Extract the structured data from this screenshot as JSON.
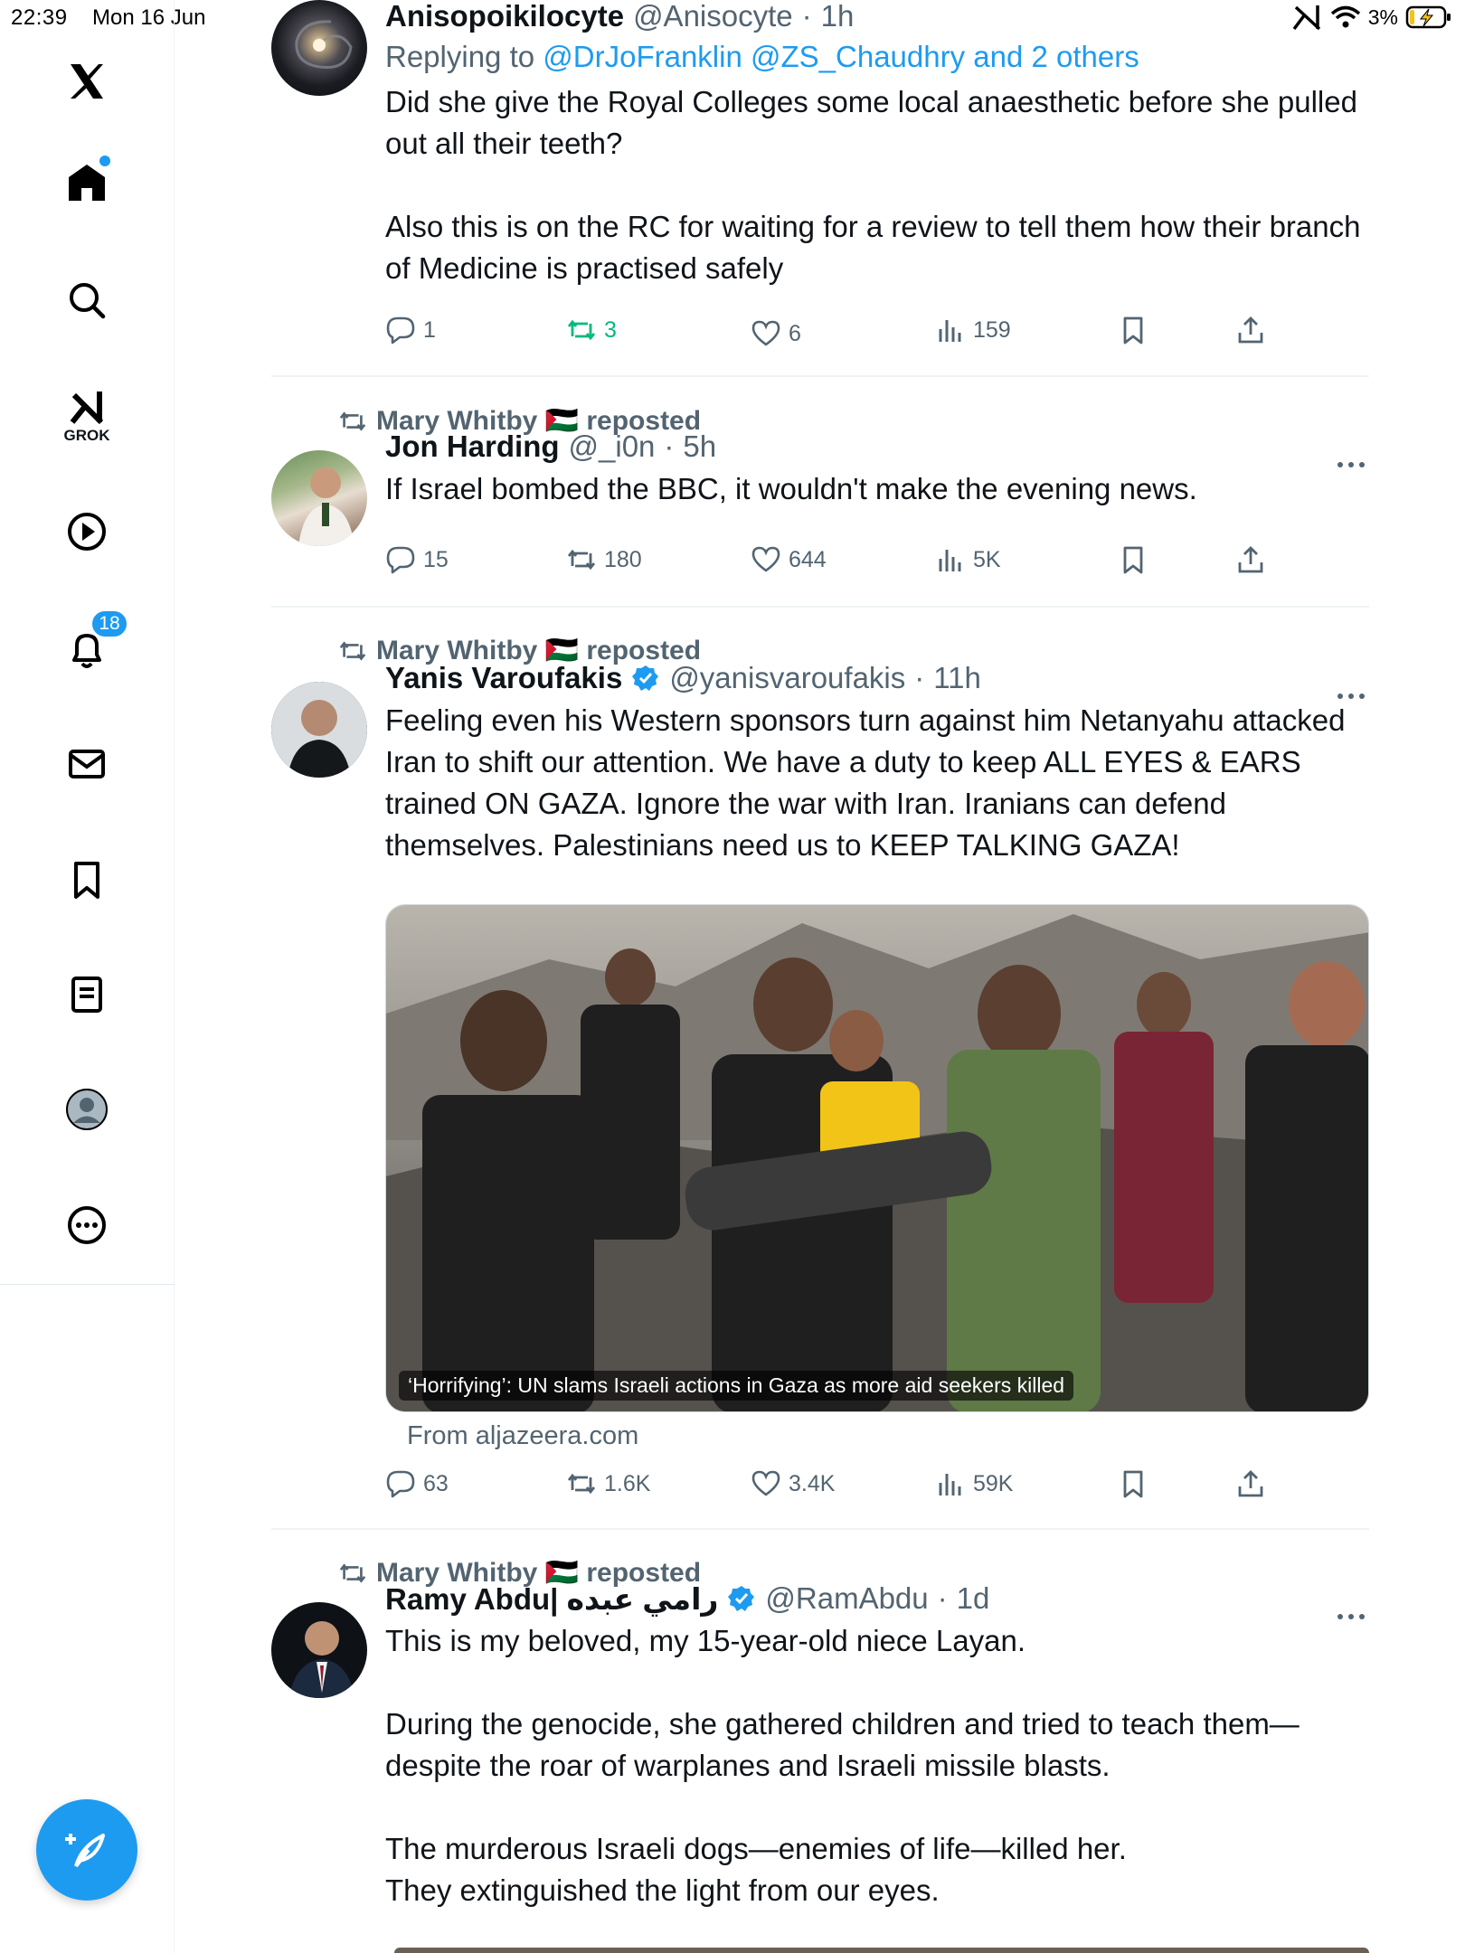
{
  "status_bar": {
    "time": "22:39",
    "date": "Mon 16 Jun",
    "battery_percent": "3%",
    "charging": true
  },
  "sidebar": {
    "items": [
      {
        "id": "logo",
        "icon": "x-logo-icon",
        "label": ""
      },
      {
        "id": "home",
        "icon": "home-icon",
        "label": "",
        "has_dot": true
      },
      {
        "id": "explore",
        "icon": "search-icon",
        "label": ""
      },
      {
        "id": "grok",
        "icon": "grok-icon",
        "label": "GROK"
      },
      {
        "id": "videos",
        "icon": "play-icon",
        "label": ""
      },
      {
        "id": "notifications",
        "icon": "bell-icon",
        "label": "",
        "badge": "18"
      },
      {
        "id": "messages",
        "icon": "mail-icon",
        "label": ""
      },
      {
        "id": "bookmarks",
        "icon": "bookmark-icon",
        "label": ""
      },
      {
        "id": "lists",
        "icon": "list-icon",
        "label": ""
      },
      {
        "id": "profile",
        "icon": "profile-icon",
        "label": ""
      },
      {
        "id": "more",
        "icon": "more-icon",
        "label": ""
      }
    ],
    "compose": {
      "icon": "compose-icon"
    }
  },
  "colors": {
    "accent": "#1d9bf0",
    "secondary_text": "#536471",
    "retweeted_green": "#00ba7c",
    "divider": "#eff3f4"
  },
  "tweets": [
    {
      "name": "Anisopoikilocyte",
      "handle": "@Anisocyte",
      "time": "1h",
      "reply_prefix": "Replying to",
      "reply_targets": "@DrJoFranklin @ZS_Chaudhry and 2 others",
      "text": "Did she give the Royal Colleges some local anaesthetic before she pulled out all their teeth?\n\nAlso this is on the RC for waiting for a review to tell them how their branch of Medicine is practised safely",
      "replies": "1",
      "reposts": "3",
      "likes": "6",
      "views": "159"
    },
    {
      "reposted_by": "Mary Whitby 🇵🇸 reposted",
      "name": "Jon Harding",
      "handle": "@_i0n",
      "time": "5h",
      "text": "If Israel bombed the BBC, it wouldn't make the evening news.",
      "replies": "15",
      "reposts": "180",
      "likes": "644",
      "views": "5K"
    },
    {
      "reposted_by": "Mary Whitby 🇵🇸 reposted",
      "name": "Yanis Varoufakis",
      "verified": true,
      "handle": "@yanisvaroufakis",
      "time": "11h",
      "text": "Feeling even his Western sponsors turn against him Netanyahu attacked Iran to shift our attention. We have a duty to keep ALL EYES & EARS trained ON GAZA. Ignore the war with Iran. Iranians can defend themselves. Palestinians need us to KEEP TALKING GAZA!",
      "card_caption": "‘Horrifying’: UN slams Israeli actions in Gaza as more aid seekers killed",
      "card_source": "From aljazeera.com",
      "replies": "63",
      "reposts": "1.6K",
      "likes": "3.4K",
      "views": "59K"
    },
    {
      "reposted_by": "Mary Whitby 🇵🇸 reposted",
      "name": "Ramy Abdu| رامي عبده",
      "verified": true,
      "handle": "@RamAbdu",
      "time": "1d",
      "text": "This is my beloved, my 15-year-old niece Layan.\n\nDuring the genocide, she gathered children and tried to teach them—despite the roar of warplanes and Israeli missile blasts.\n\nThe murderous Israeli dogs—enemies of life—killed her.\nThey extinguished the light from our eyes."
    }
  ]
}
